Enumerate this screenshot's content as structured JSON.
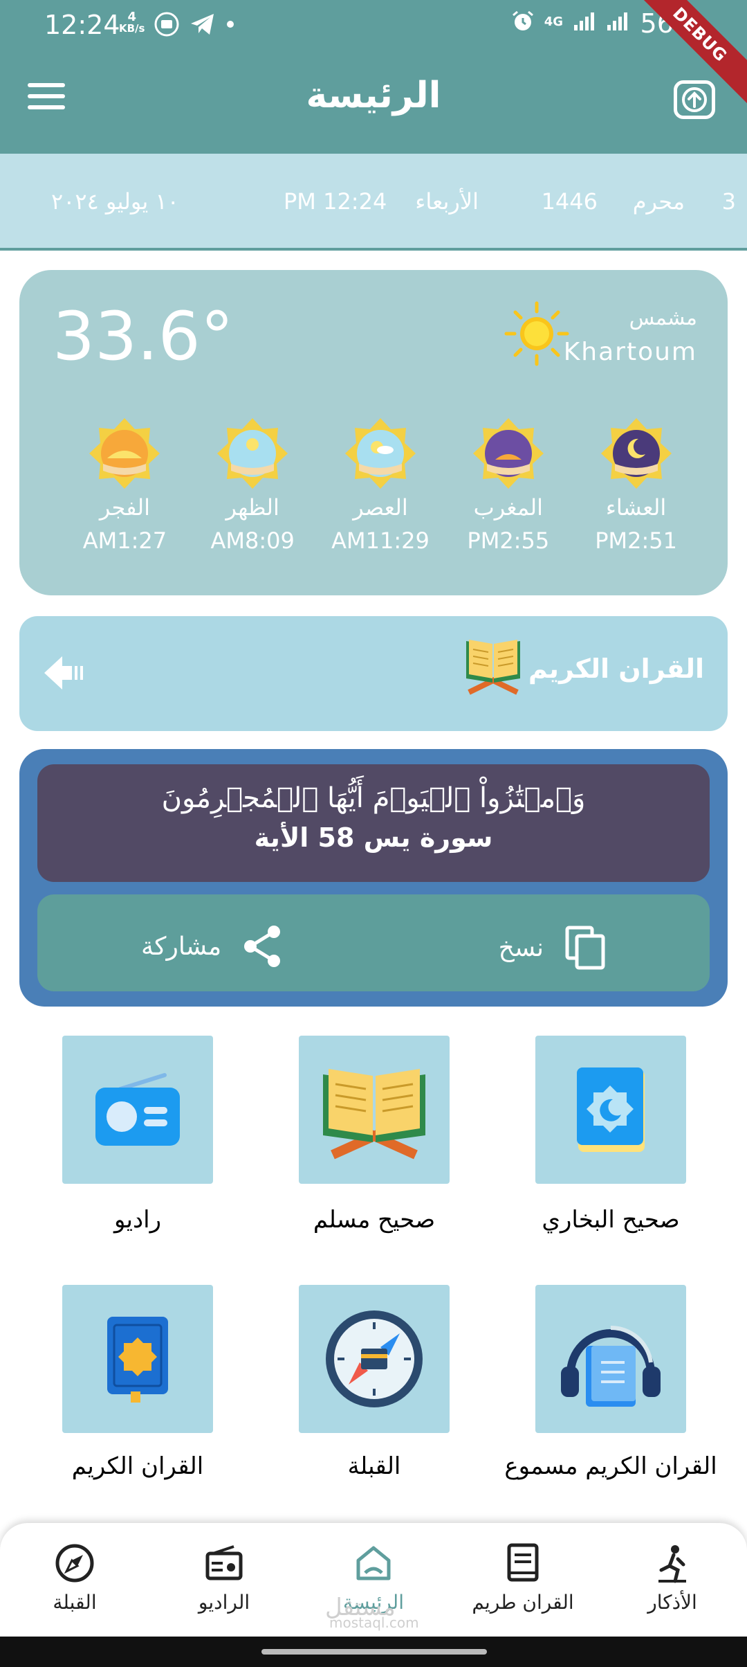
{
  "status_bar": {
    "time": "12:24",
    "speed_value": "4",
    "speed_unit": "KB/s",
    "network": "4G",
    "battery": "56%",
    "debug_banner": "DEBUG"
  },
  "appbar": {
    "title": "الرئيسة"
  },
  "date_strip": {
    "hijri_day": "3",
    "hijri_month": "محرم",
    "hijri_year": "1446",
    "weekday": "الأربعاء",
    "time": "PM 12:24",
    "gregorian": "١٠ يوليو ٢٠٢٤"
  },
  "weather": {
    "temperature": "33.6°",
    "condition": "مشمس",
    "city": "Khartoum",
    "sun_color": "#f9c51b",
    "prayers": [
      {
        "name": "الفجر",
        "time": "AM1:27"
      },
      {
        "name": "الظهر",
        "time": "AM8:09"
      },
      {
        "name": "العصر",
        "time": "AM11:29"
      },
      {
        "name": "المغرب",
        "time": "PM2:55"
      },
      {
        "name": "العشاء",
        "time": "PM2:51"
      }
    ]
  },
  "quran_card": {
    "label": "القران الكريم"
  },
  "ayah": {
    "text": "وَٱمۡتَٰزُواْ ٱلۡيَوۡمَ أَيُّهَا ٱلۡمُجۡرِمُونَ",
    "reference": "سورة يس 58 الأية",
    "copy_label": "نسخ",
    "share_label": "مشاركة"
  },
  "grid": [
    {
      "label": "راديو",
      "icon": "radio-icon"
    },
    {
      "label": "صحيح مسلم",
      "icon": "open-book-icon"
    },
    {
      "label": "صحيح البخاري",
      "icon": "book-icon"
    },
    {
      "label": "القران الكريم",
      "icon": "quran-book-icon"
    },
    {
      "label": "القبلة",
      "icon": "compass-icon"
    },
    {
      "label": "القران الكريم مسموع",
      "icon": "headphones-book-icon"
    }
  ],
  "bottom_nav": [
    {
      "label": "القبلة",
      "icon": "compass-icon"
    },
    {
      "label": "الراديو",
      "icon": "radio-icon"
    },
    {
      "label": "الرئيسة",
      "icon": "home-icon",
      "active": true
    },
    {
      "label": "القران طريم",
      "icon": "book-icon"
    },
    {
      "label": "الأذكار",
      "icon": "prayer-person-icon"
    }
  ],
  "watermark": {
    "name": "مستقل",
    "url": "mostaql.com"
  },
  "colors": {
    "primary": "#5f9e9d",
    "date_strip": "#bfe0e8",
    "weather_card": "#a9cfd2",
    "tile": "#acd8e4",
    "ayah_outer": "#4a7fb7",
    "ayah_inner": "#524a65"
  }
}
